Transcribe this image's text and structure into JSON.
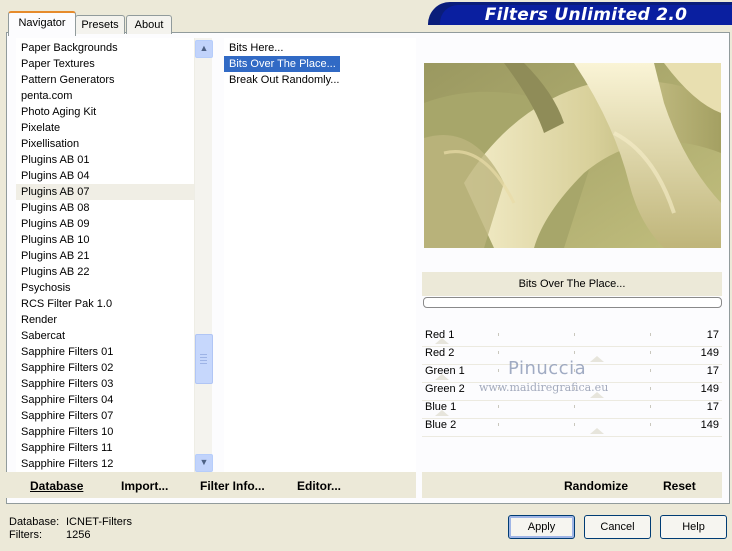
{
  "title": "Filters Unlimited 2.0",
  "tabs": [
    {
      "label": "Navigator",
      "active": true
    },
    {
      "label": "Presets",
      "active": false
    },
    {
      "label": "About",
      "active": false
    }
  ],
  "categories": {
    "items": [
      "Paper Backgrounds",
      "Paper Textures",
      "Pattern Generators",
      "penta.com",
      "Photo Aging Kit",
      "Pixelate",
      "Pixellisation",
      "Plugins AB 01",
      "Plugins AB 04",
      "Plugins AB 07",
      "Plugins AB 08",
      "Plugins AB 09",
      "Plugins AB 10",
      "Plugins AB 21",
      "Plugins AB 22",
      "Psychosis",
      "RCS Filter Pak 1.0",
      "Render",
      "Sabercat",
      "Sapphire Filters 01",
      "Sapphire Filters 02",
      "Sapphire Filters 03",
      "Sapphire Filters 04",
      "Sapphire Filters 07",
      "Sapphire Filters 10",
      "Sapphire Filters 11",
      "Sapphire Filters 12"
    ],
    "selected": "Plugins AB 07"
  },
  "filters": {
    "items": [
      "Bits Here...",
      "Bits Over The Place...",
      "Break Out Randomly..."
    ],
    "selected": "Bits Over The Place..."
  },
  "preview": {
    "filter_name": "Bits Over The Place..."
  },
  "sliders": [
    {
      "label": "Red 1",
      "value": "17"
    },
    {
      "label": "Red 2",
      "value": "149"
    },
    {
      "label": "Green 1",
      "value": "17"
    },
    {
      "label": "Green 2",
      "value": "149"
    },
    {
      "label": "Blue 1",
      "value": "17"
    },
    {
      "label": "Blue 2",
      "value": "149"
    }
  ],
  "watermark": {
    "name": "Pinuccia",
    "url": "www.maidiregrafica.eu"
  },
  "toolbar": {
    "database": "Database",
    "import": "Import...",
    "filter_info": "Filter Info...",
    "editor": "Editor...",
    "randomize": "Randomize",
    "reset": "Reset"
  },
  "status": {
    "database_label": "Database:",
    "database_value": "ICNET-Filters",
    "filters_label": "Filters:",
    "filters_value": "1256"
  },
  "buttons": {
    "apply": "Apply",
    "cancel": "Cancel",
    "help": "Help"
  },
  "colors": {
    "banner": "#0a1fa0",
    "selection": "#316ac5",
    "tab_accent": "#e68b2c"
  }
}
